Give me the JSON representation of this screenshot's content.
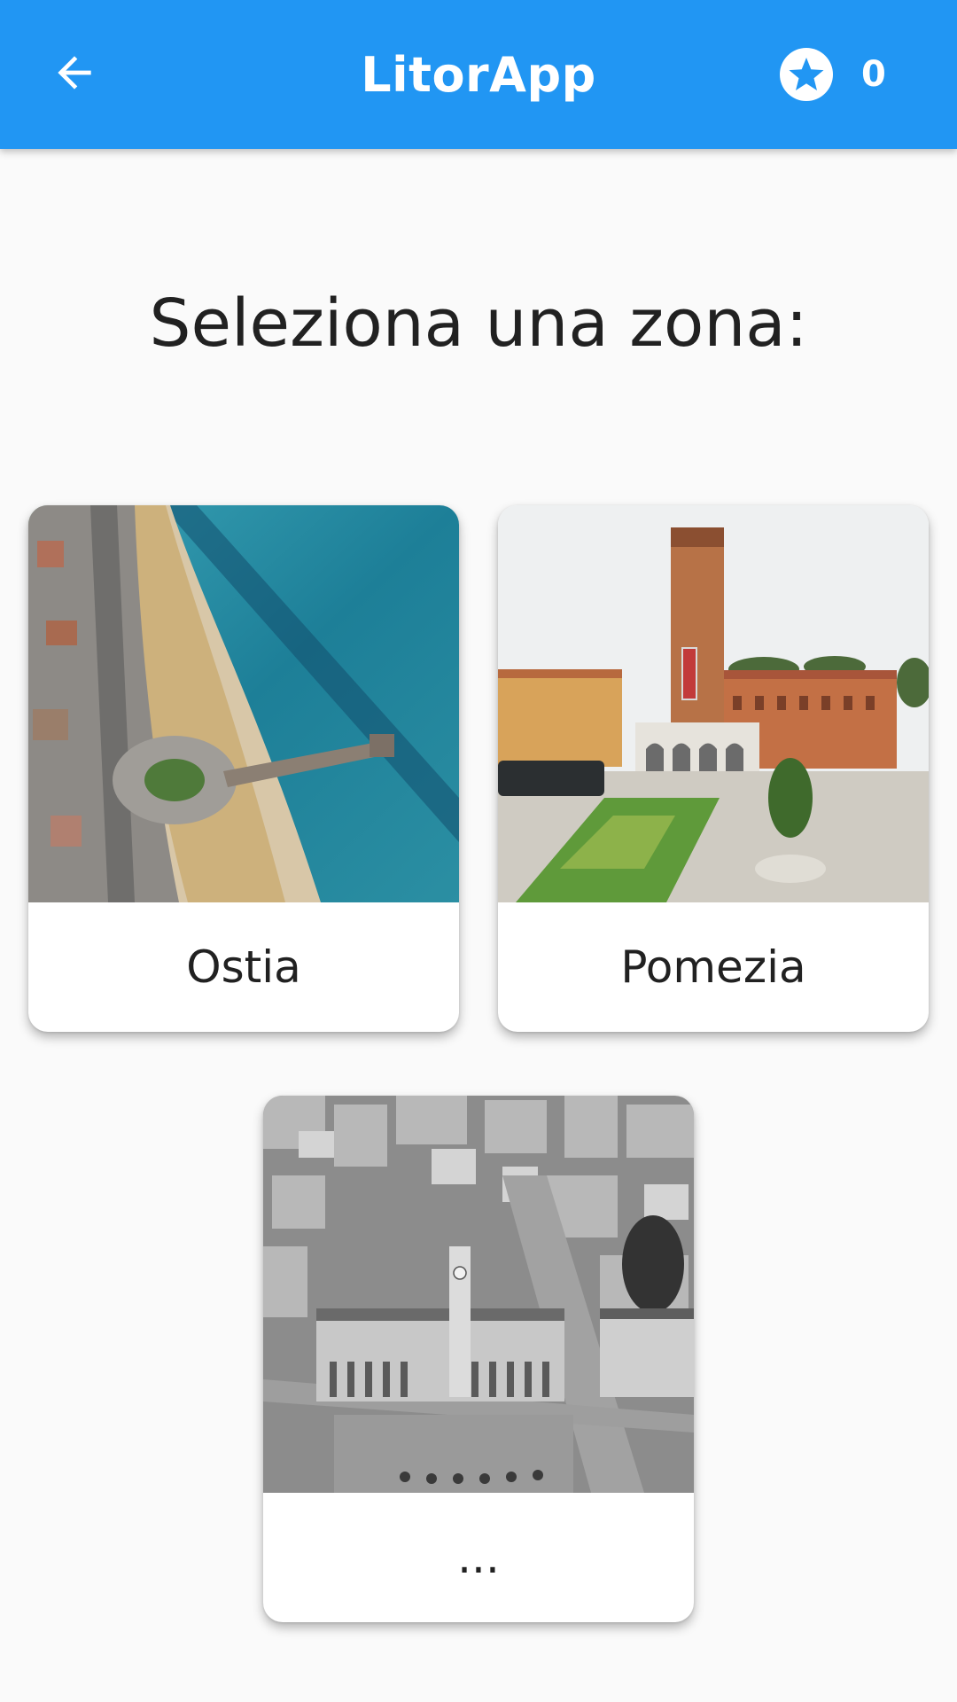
{
  "app_bar": {
    "title": "LitorApp",
    "score": "0",
    "back_icon": "arrow-left-icon",
    "star_icon": "star-circle-icon",
    "color": "#2196f3"
  },
  "page": {
    "heading": "Seleziona una zona:"
  },
  "zones": [
    {
      "label": "Ostia",
      "image": "aerial-beach-pier-photo"
    },
    {
      "label": "Pomezia",
      "image": "clock-tower-piazza-photo"
    },
    {
      "label": "...",
      "image": "aerial-city-grayscale-photo"
    }
  ]
}
